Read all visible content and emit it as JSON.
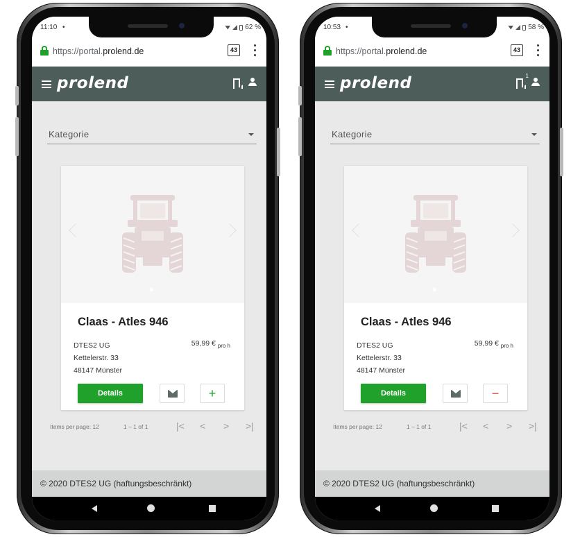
{
  "phones": [
    {
      "status": {
        "time": "11:10",
        "dot": "•",
        "battery": "62 %"
      },
      "browser": {
        "url_scheme": "https://portal.",
        "url_domain": "prolend.de",
        "tab_count": "43"
      },
      "app": {
        "logo": "prolend",
        "bookmark_count": ""
      },
      "filter": {
        "label": "Kategorie"
      },
      "card": {
        "title": "Claas - Atles 946",
        "company": "DTES2 UG",
        "street": "Kettelerstr. 33",
        "city": "48147 Münster",
        "price": "59,99 €",
        "price_unit": "pro h",
        "details_label": "Details",
        "toggle_symbol": "+",
        "toggle_state": "add"
      },
      "paginator": {
        "items_per_page": "Items per page: 12",
        "range": "1 – 1 of 1"
      },
      "footer": "© 2020 DTES2 UG (haftungsbeschränkt)"
    },
    {
      "status": {
        "time": "10:53",
        "dot": "•",
        "battery": "58 %"
      },
      "browser": {
        "url_scheme": "https://portal.",
        "url_domain": "prolend.de",
        "tab_count": "43"
      },
      "app": {
        "logo": "prolend",
        "bookmark_count": "1"
      },
      "filter": {
        "label": "Kategorie"
      },
      "card": {
        "title": "Claas - Atles 946",
        "company": "DTES2 UG",
        "street": "Kettelerstr. 33",
        "city": "48147 Münster",
        "price": "59,99 €",
        "price_unit": "pro h",
        "details_label": "Details",
        "toggle_symbol": "−",
        "toggle_state": "remove"
      },
      "paginator": {
        "items_per_page": "Items per page: 12",
        "range": "1 – 1 of 1"
      },
      "footer": "© 2020 DTES2 UG (haftungsbeschränkt)"
    }
  ],
  "icons": {
    "paginator_first": "|<",
    "paginator_prev": "<",
    "paginator_next": ">",
    "paginator_last": ">|"
  },
  "colors": {
    "brand_green": "#1fa12b",
    "appbar": "#4d5d5a",
    "remove_red": "#d93b2b",
    "footer_bg": "#d2d5d4"
  }
}
